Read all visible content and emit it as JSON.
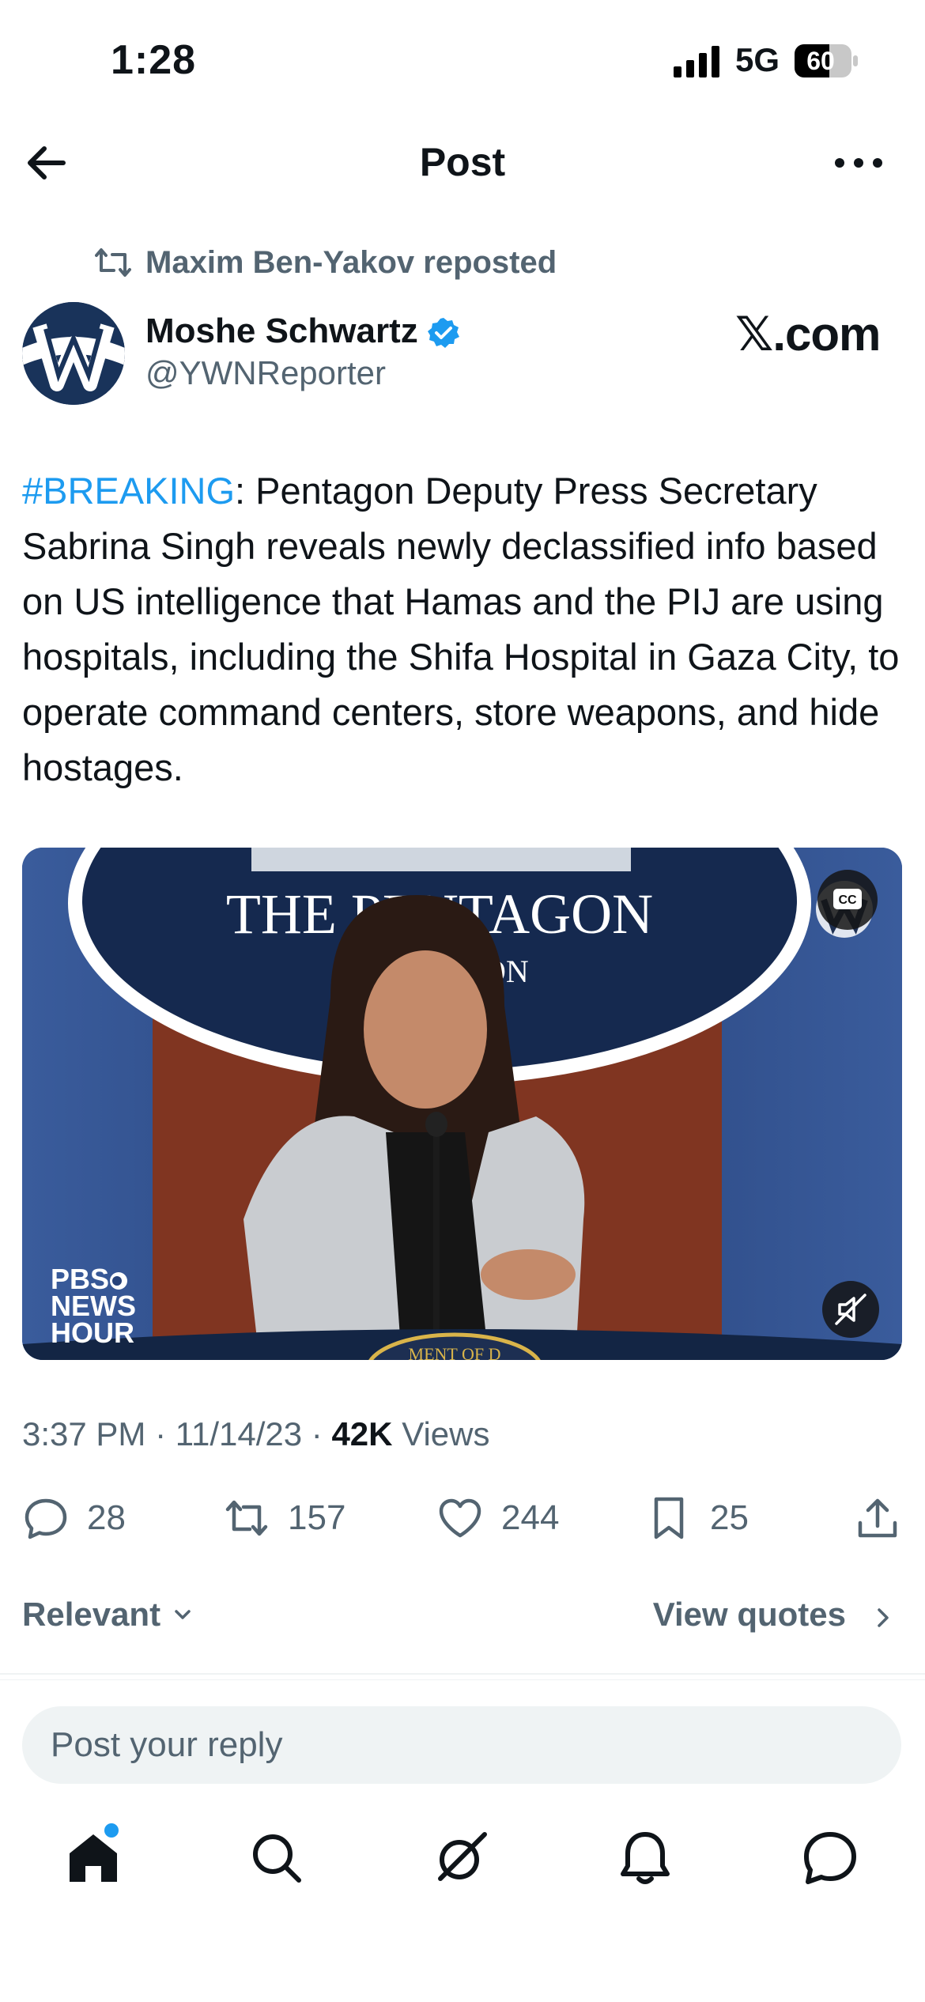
{
  "status_bar": {
    "time": "1:28",
    "network": "5G",
    "battery": "60"
  },
  "header": {
    "title": "Post"
  },
  "repost": {
    "text": "Maxim Ben-Yakov reposted"
  },
  "author": {
    "name": "Moshe Schwartz",
    "handle": "@YWNReporter",
    "source_label": "𝕏.com"
  },
  "post": {
    "hashtag": "#BREAKING",
    "body": ": Pentagon Deputy Press Secretary Sabrina Singh reveals newly declassified info based on US intelligence that Hamas and the PIJ are using hospitals, including the Shifa Hospital in Gaza City, to operate command centers, store weapons, and hide hostages."
  },
  "video": {
    "seal_text": "THE PENTAGON",
    "seal_subtext": "TON",
    "podium_text": "MENT OF D",
    "brand_lines": [
      "PBS",
      "NEWS",
      "HOUR"
    ],
    "cc_label": "CC"
  },
  "meta": {
    "time": "3:37 PM",
    "date": "11/14/23",
    "views_count": "42K",
    "views_label": "Views"
  },
  "actions": {
    "replies": "28",
    "reposts": "157",
    "likes": "244",
    "bookmarks": "25"
  },
  "sort": {
    "label": "Relevant",
    "view_quotes": "View quotes"
  },
  "reply_box": {
    "placeholder": "Post your reply"
  },
  "tabbar": {
    "items": [
      "home-icon",
      "search-icon",
      "grok-icon",
      "bell-icon",
      "messages-icon"
    ]
  }
}
